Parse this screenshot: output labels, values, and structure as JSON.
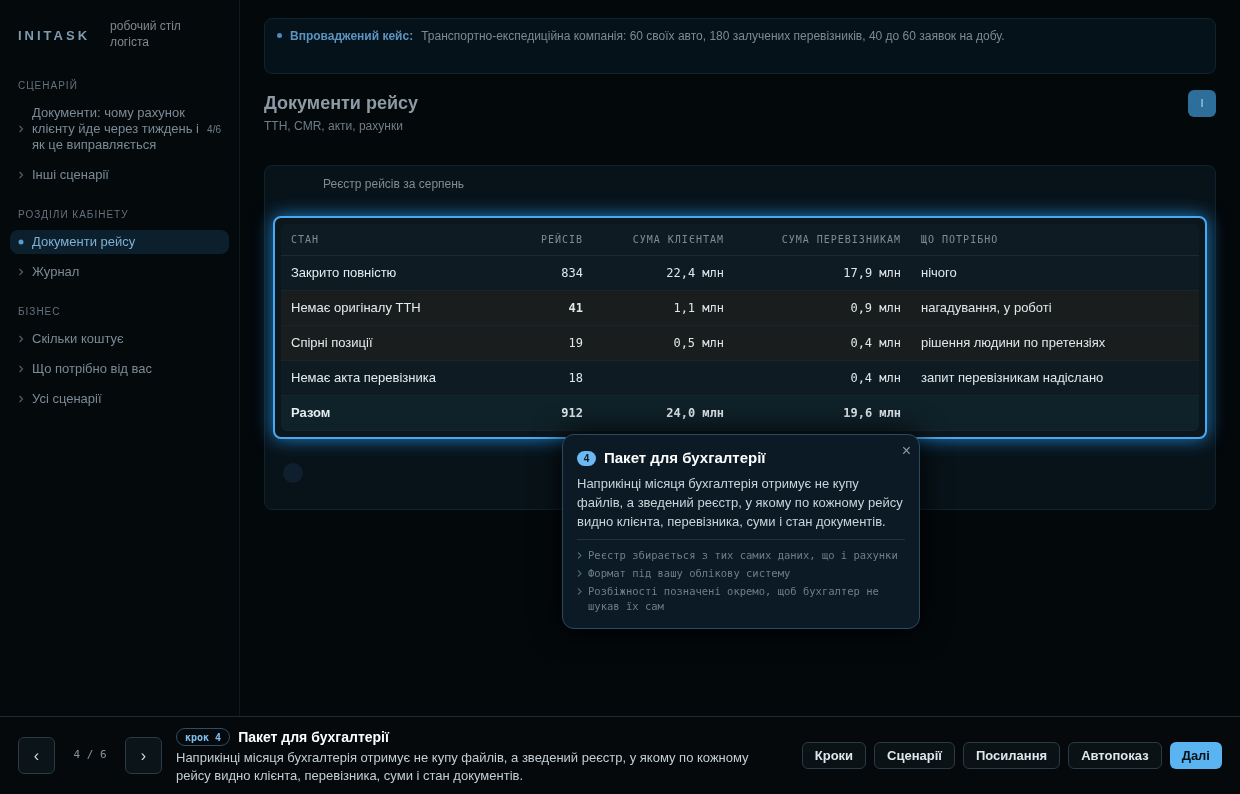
{
  "sidebar": {
    "logo": "INITASK",
    "subtitle": "робочий стіл логіста",
    "sections": [
      {
        "title": "СЦЕНАРІЙ",
        "items": [
          {
            "label": "Документи: чому рахунок клієнту йде через тиждень і як це виправляється",
            "count": "4/6",
            "selected": false
          },
          {
            "label": "Інші сценарії",
            "selected": false
          }
        ]
      },
      {
        "title": "РОЗДІЛИ КАБІНЕТУ",
        "items": [
          {
            "label": "Документи рейсу",
            "selected": true
          },
          {
            "label": "Журнал",
            "selected": false
          }
        ]
      },
      {
        "title": "БІЗНЕС",
        "items": [
          {
            "label": "Скільки коштує",
            "selected": false
          },
          {
            "label": "Що потрібно від вас",
            "selected": false
          },
          {
            "label": "Усі сценарії",
            "selected": false
          }
        ]
      }
    ]
  },
  "banner": {
    "label": "Впроваджений кейс:",
    "text": "Транспортно-експедиційна компанія: 60 своїх авто, 180 залучених перевізників, 40 до 60 заявок на добу."
  },
  "header": {
    "title": "Документи рейсу",
    "subtitle": "ТТН, CMR, акти, рахунки",
    "avatar": "І"
  },
  "card": {
    "title": "Реєстр рейсів за серпень"
  },
  "table": {
    "columns": [
      "СТАН",
      "РЕЙСІВ",
      "СУМА КЛІЄНТАМ",
      "СУМА ПЕРЕВІЗНИКАМ",
      "ЩО ПОТРІБНО"
    ],
    "rows": [
      {
        "kind": "normal",
        "count_bold": false,
        "cells": [
          "Закрито повністю",
          "834",
          "22,4 млн",
          "17,9 млн",
          "нічого"
        ]
      },
      {
        "kind": "warn",
        "count_bold": true,
        "cells": [
          "Немає оригіналу ТТН",
          "41",
          "1,1 млн",
          "0,9 млн",
          "нагадування, у роботі"
        ]
      },
      {
        "kind": "warn",
        "count_bold": false,
        "cells": [
          "Спірні позиції",
          "19",
          "0,5 млн",
          "0,4 млн",
          "рішення людини по претензіях"
        ]
      },
      {
        "kind": "normal",
        "count_bold": false,
        "cells": [
          "Немає акта перевізника",
          "18",
          "",
          "0,4 млн",
          "запит перевізникам надіслано"
        ]
      },
      {
        "kind": "total",
        "cells": [
          "Разом",
          "912",
          "24,0 млн",
          "19,6 млн",
          ""
        ]
      }
    ]
  },
  "tooltip": {
    "close": "×",
    "step": "4",
    "title": "Пакет для бухгалтерії",
    "text": "Наприкінці місяця бухгалтерія отримує не купу файлів, а зведений реєстр, у якому по кожному рейсу видно клієнта, перевізника, суми і стан документів.",
    "points": [
      "Реєстр збирається з тих самих даних, що і рахунки",
      "Формат під вашу облікову систему",
      "Розбіжності позначені окремо, щоб бухгалтер не шукав їх сам"
    ]
  },
  "footer": {
    "prev": "‹",
    "position": "4 / 6",
    "next": "›",
    "badge": "крок 4",
    "title": "Пакет для бухгалтерії",
    "text": "Наприкінці місяця бухгалтерія отримує не купу файлів, а зведений реєстр, у якому по кожному рейсу видно клієнта, перевізника, суми і стан документів.",
    "buttons": [
      {
        "label": "Кроки",
        "primary": false
      },
      {
        "label": "Сценарії",
        "primary": false
      },
      {
        "label": "Посилання",
        "primary": false
      },
      {
        "label": "Автопоказ",
        "primary": false
      },
      {
        "label": "Далі",
        "primary": true
      }
    ]
  }
}
